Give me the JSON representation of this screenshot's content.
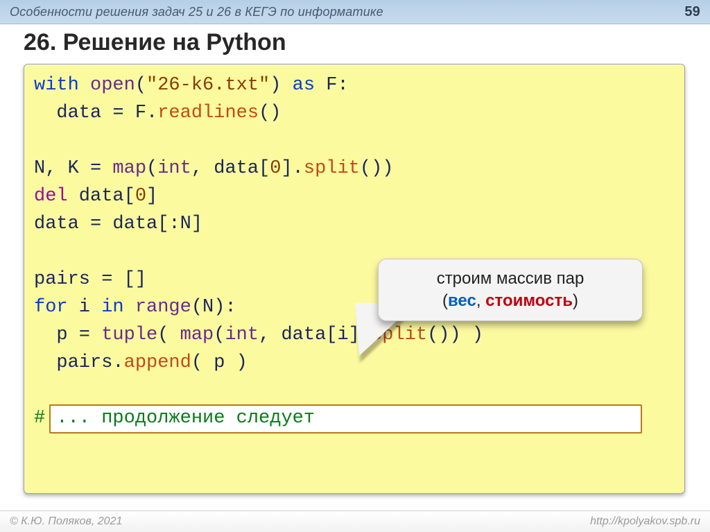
{
  "header": {
    "lecture_title": "Особенности решения задач 25 и 26 в КЕГЭ по информатике",
    "page_number": "59"
  },
  "heading": "26. Решение на Python",
  "code": {
    "l1": {
      "kw1": "with",
      "fn": "open",
      "p1": "(",
      "str": "\"26-k6.txt\"",
      "p2": ") ",
      "kw2": "as",
      "rest": " F:"
    },
    "l2": {
      "indent": "  ",
      "t1": "data = F.",
      "fn": "readlines",
      "t2": "()"
    },
    "l3": "",
    "l4": {
      "t1": "N, K = ",
      "fn1": "map",
      "t2": "(",
      "fn2": "int",
      "t3": ", data[",
      "n": "0",
      "t4": "].",
      "fn3": "split",
      "t5": "())"
    },
    "l5": {
      "kw": "del",
      "rest": " data[",
      "n": "0",
      "close": "]"
    },
    "l6": "data = data[:N]",
    "l7": "",
    "l8": "pairs = []",
    "l9": {
      "kw1": "for",
      "mid": " i ",
      "kw2": "in",
      "sp": " ",
      "fn": "range",
      "rest": "(N):"
    },
    "l10": {
      "indent": "  ",
      "t1": "p = ",
      "fn1": "tuple",
      "t2": "( ",
      "fn2": "map",
      "t3": "(",
      "fn3": "int",
      "t4": ", data[i].",
      "fn4": "split",
      "t5": "()) )"
    },
    "l11": {
      "indent": "  ",
      "t1": "pairs.",
      "fn": "append",
      "t2": "( p )"
    },
    "l12": "",
    "l13": "# ... продолжение следует"
  },
  "callout": {
    "line1": "строим массив пар",
    "paren_open": "(",
    "weight": "вес",
    "comma": ", ",
    "cost": "стоимость",
    "paren_close": ")"
  },
  "footer": {
    "author": "© К.Ю. Поляков, 2021",
    "url": "http://kpolyakov.spb.ru"
  }
}
